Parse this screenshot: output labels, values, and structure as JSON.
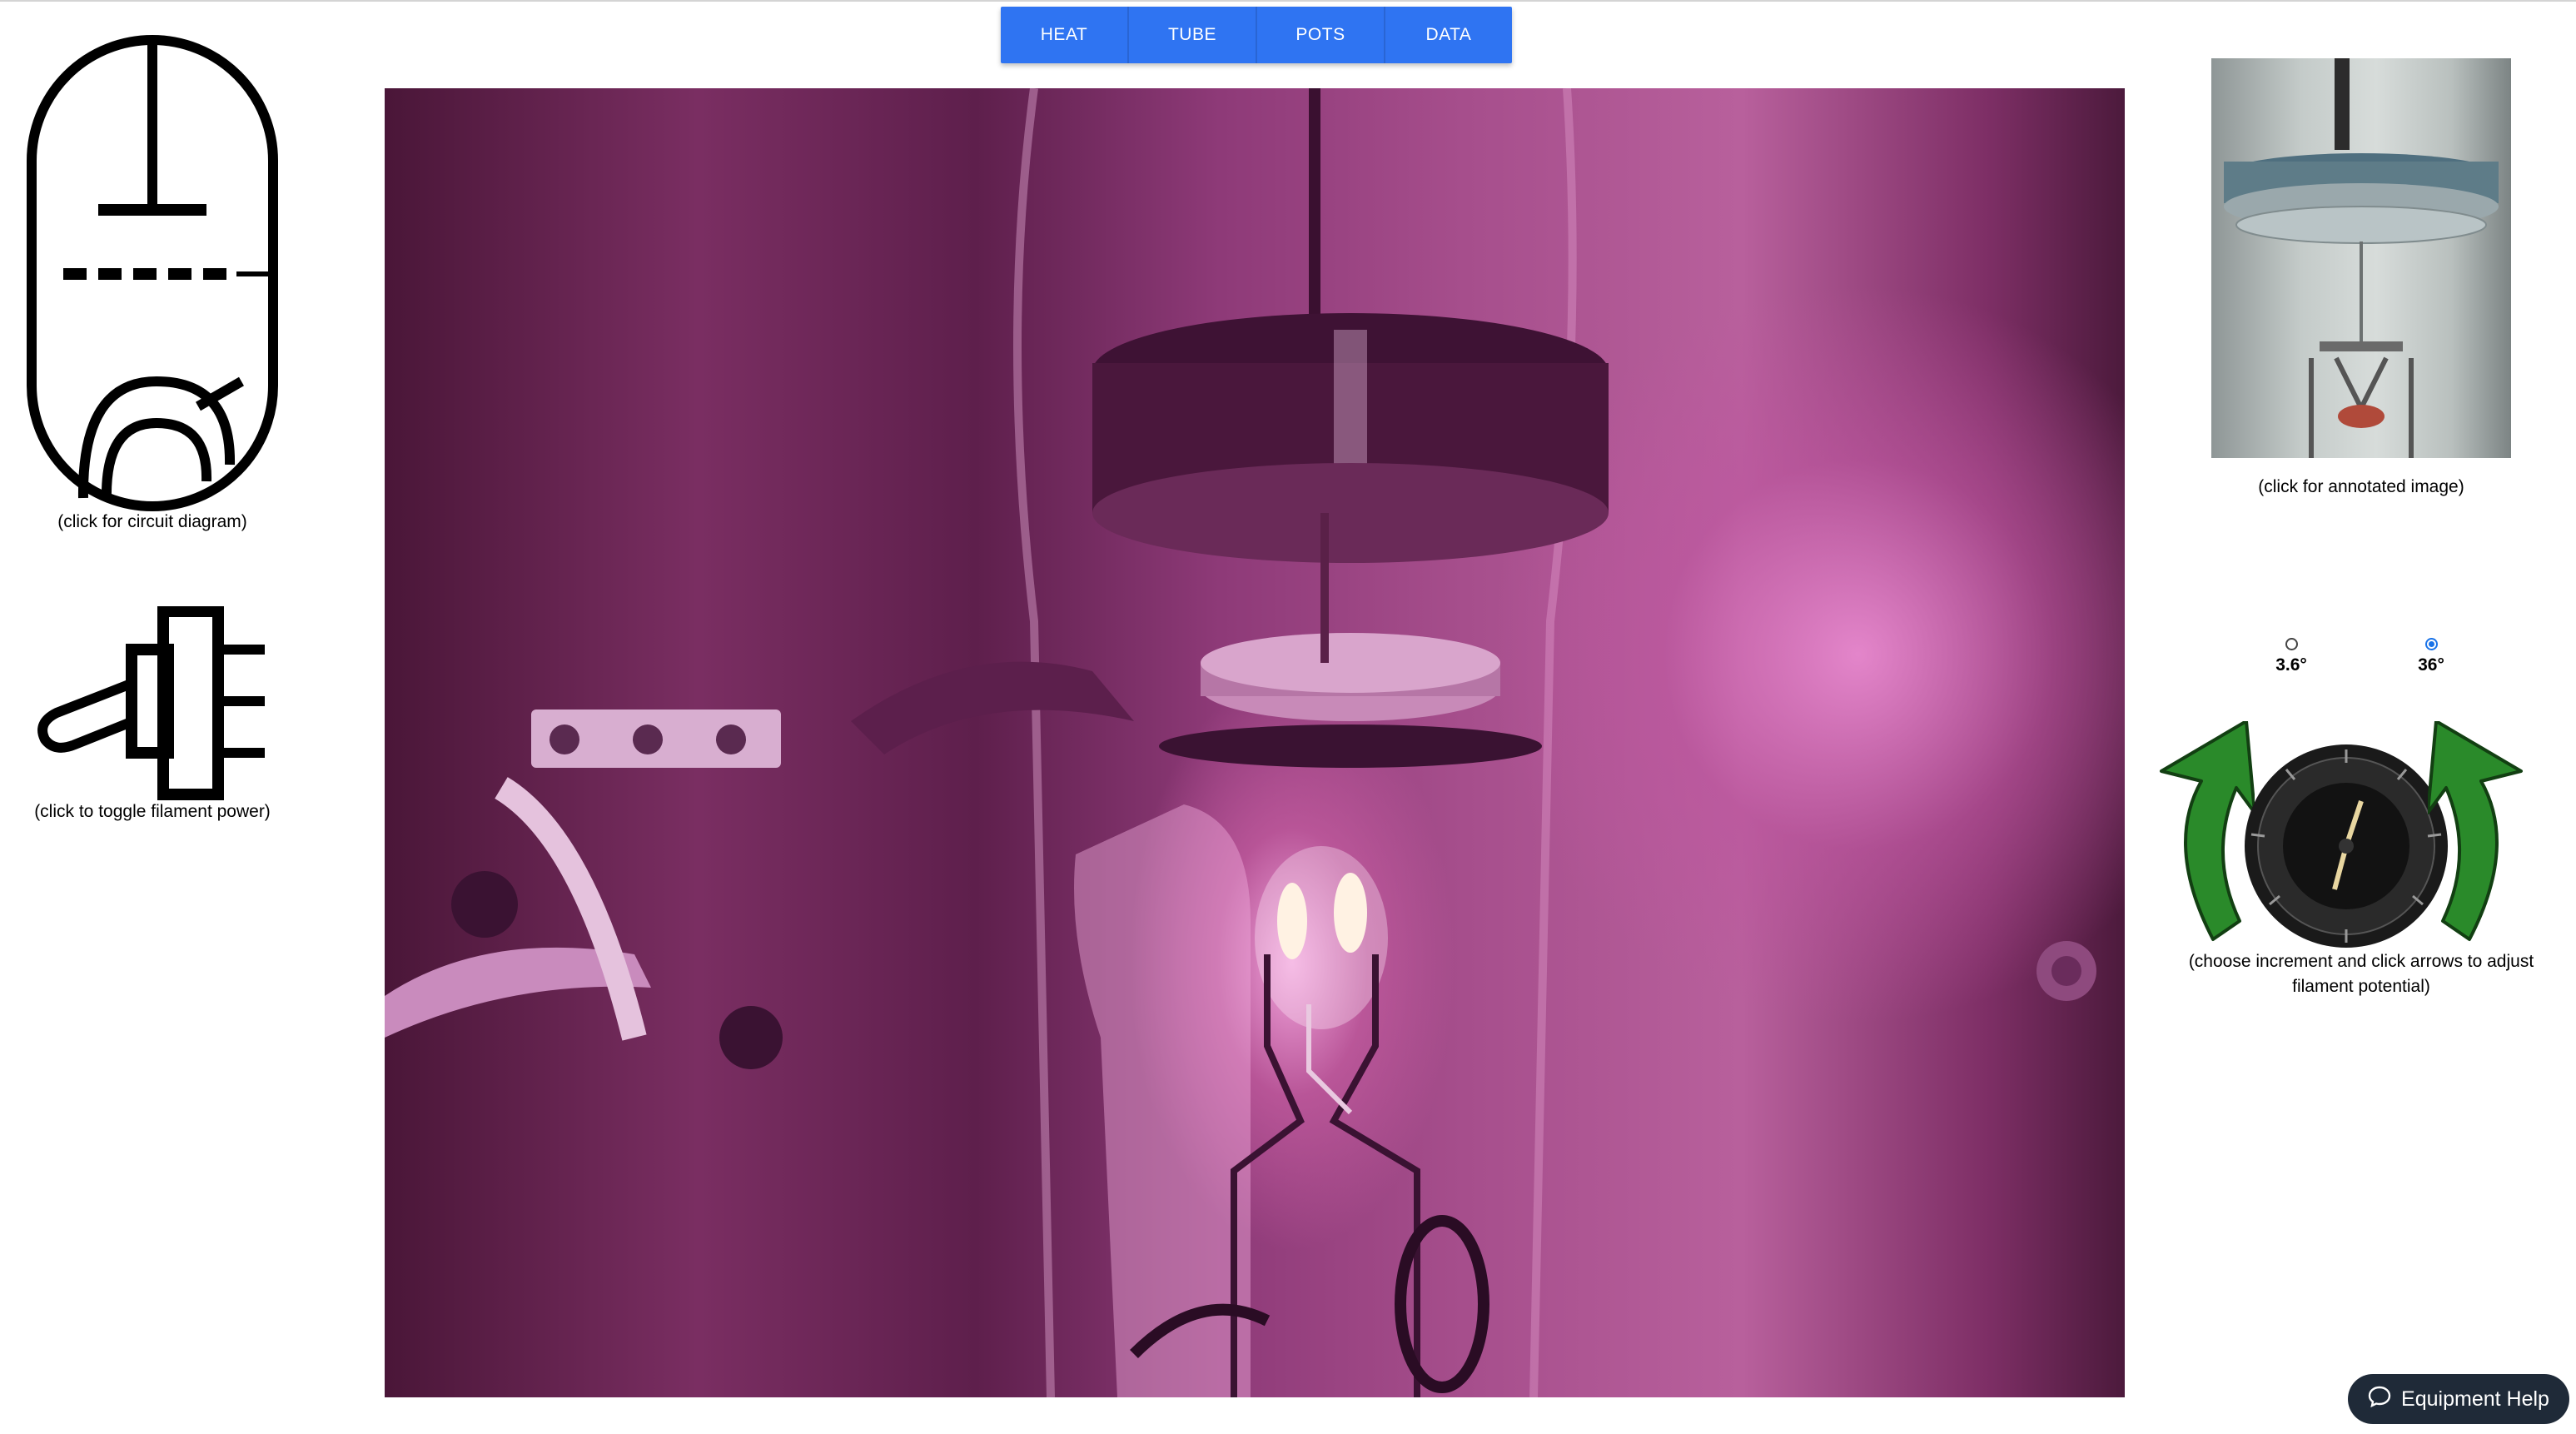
{
  "nav": {
    "tabs": [
      {
        "label": "HEAT"
      },
      {
        "label": "TUBE"
      },
      {
        "label": "POTS"
      },
      {
        "label": "DATA"
      }
    ],
    "color": "#2f74f2"
  },
  "left_panel": {
    "circuit_caption": "(click for circuit diagram)",
    "filament_caption": "(click to toggle filament power)",
    "circuit_icon": "vacuum-tube-triode-icon",
    "switch_icon": "toggle-switch-icon"
  },
  "video": {
    "description_icon": "vacuum-tube-camera-view"
  },
  "right_panel": {
    "annotated_caption": "(click for annotated image)",
    "increments": [
      {
        "label": "3.6°",
        "selected": false
      },
      {
        "label": "36°",
        "selected": true
      }
    ],
    "knob_caption_line1": "(choose increment and click arrows to adjust",
    "knob_caption_line2": "filament potential)",
    "knob_scale": [
      "10",
      "20",
      "30",
      "40",
      "50",
      "60",
      "70",
      "80",
      "90",
      "100"
    ],
    "arrow_color": "#2a8a2a"
  },
  "help": {
    "label": "Equipment Help",
    "icon": "chat-bubble-icon"
  }
}
